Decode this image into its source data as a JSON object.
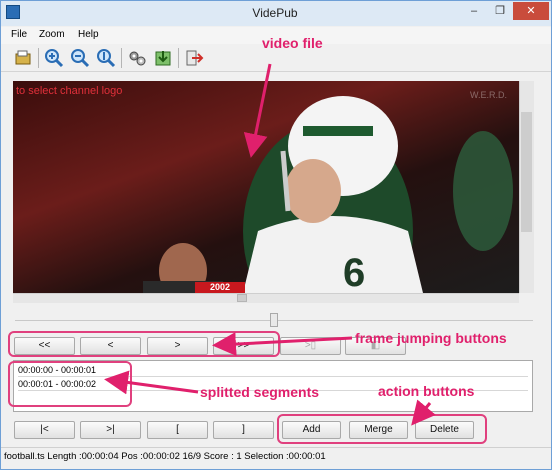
{
  "window": {
    "title": "VidePub",
    "minimize": "–",
    "restore": "❐",
    "close": "✕"
  },
  "menu": [
    "File",
    "Zoom",
    "Help"
  ],
  "toolbar": [
    "open-icon",
    "zoom-in-icon",
    "zoom-out-icon",
    "zoom-reset-icon",
    "settings-icon",
    "save-icon",
    "exit-icon"
  ],
  "video": {
    "overlay_hint": "to select channel logo",
    "score_overlay": "2002",
    "watermark": "W.E.R.D."
  },
  "nav_buttons": [
    "<<",
    "<",
    ">",
    ">>",
    ">▯",
    "◧"
  ],
  "segments": [
    "00:00:00 - 00:00:01",
    "00:00:01 - 00:00:02"
  ],
  "mark_buttons": [
    "|<",
    ">|",
    "[",
    "]"
  ],
  "action_buttons": [
    "Add",
    "Merge",
    "Delete"
  ],
  "status": "football.ts  Length :00:00:04  Pos :00:00:02  16/9  Score :   1  Selection :00:00:01",
  "annotations": {
    "video": "video file",
    "frame": "frame jumping buttons",
    "segments": "splitted segments",
    "actions": "action buttons"
  },
  "colors": {
    "annotation": "#e0206c",
    "accent": "#2a6db5"
  }
}
